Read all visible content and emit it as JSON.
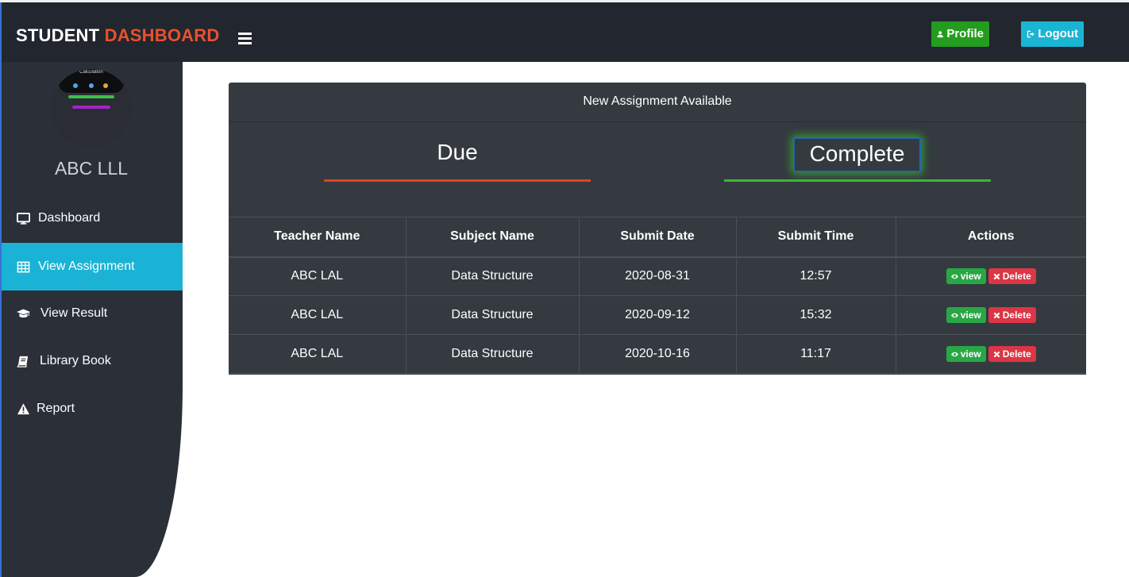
{
  "header": {
    "brand_first": "STUDENT",
    "brand_second": "DASHBOARD",
    "profile_label": "Profile",
    "logout_label": "Logout"
  },
  "sidebar": {
    "avatar_caption": "Calculation",
    "username": "ABC LLL",
    "items": [
      {
        "label": "Dashboard",
        "icon": "monitor-icon",
        "active": false
      },
      {
        "label": "View Assignment",
        "icon": "table-icon",
        "active": true
      },
      {
        "label": "View Result",
        "icon": "graduation-cap-icon",
        "active": false
      },
      {
        "label": "Library Book",
        "icon": "book-icon",
        "active": false
      },
      {
        "label": "Report",
        "icon": "warning-icon",
        "active": false
      }
    ]
  },
  "assignments": {
    "heading": "New Assignment Available",
    "due_label": "Due",
    "complete_label": "Complete",
    "columns": [
      "Teacher Name",
      "Subject Name",
      "Submit Date",
      "Submit Time",
      "Actions"
    ],
    "rows": [
      {
        "teacher": "ABC LAL",
        "subject": "Data Structure",
        "date": "2020-08-31",
        "time": "12:57"
      },
      {
        "teacher": "ABC LAL",
        "subject": "Data Structure",
        "date": "2020-09-12",
        "time": "15:32"
      },
      {
        "teacher": "ABC LAL",
        "subject": "Data Structure",
        "date": "2020-10-16",
        "time": "11:17"
      }
    ],
    "view_label": "view",
    "delete_label": "Delete"
  },
  "colors": {
    "accent": "#e8512f",
    "active_nav": "#1bb3d5",
    "profile_btn": "#239c1f",
    "logout_btn": "#1ab5d3",
    "due_line": "#e04323",
    "complete_line": "#3fb536"
  }
}
